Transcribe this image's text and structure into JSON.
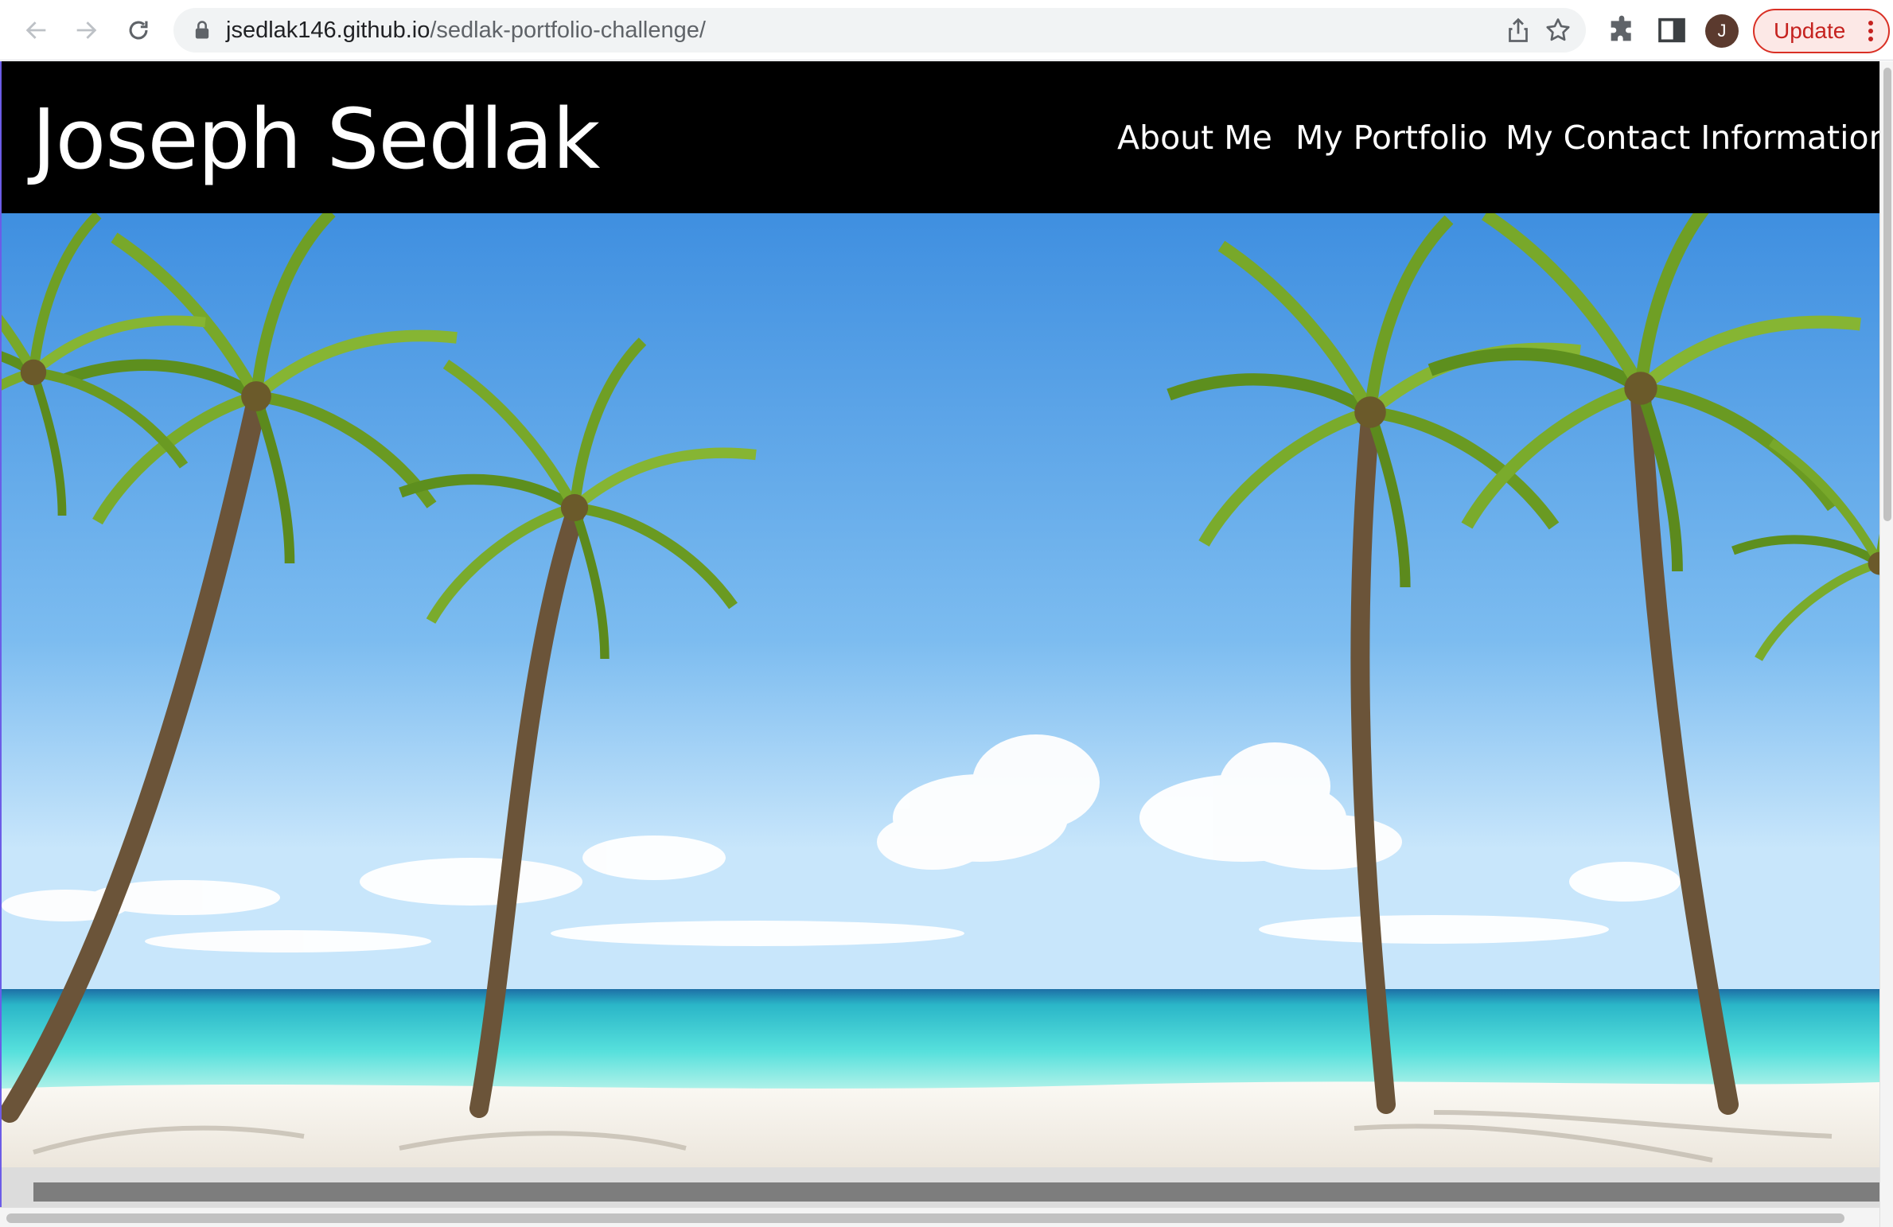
{
  "browser": {
    "url_host": "jsedlak146.github.io",
    "url_path": "/sedlak-portfolio-challenge/",
    "profile_initial": "J",
    "update_label": "Update",
    "icons": [
      "back-arrow-icon",
      "forward-arrow-icon",
      "reload-icon",
      "lock-icon",
      "share-icon",
      "star-icon",
      "extensions-puzzle-icon",
      "side-panel-icon",
      "kebab-menu-icon"
    ]
  },
  "site": {
    "title": "Joseph Sedlak",
    "nav": [
      {
        "label": "About Me"
      },
      {
        "label": "My Portfolio"
      },
      {
        "label": "My Contact Information"
      }
    ],
    "hero_image": "tropical beach with palm trees, turquoise sea and blue sky"
  },
  "colors": {
    "header_bg": "#000000",
    "header_text": "#ffffff",
    "update_accent": "#d93025",
    "sky": "#4d9be6",
    "sea": "#3fd6d6",
    "sand": "#f3efe9"
  }
}
